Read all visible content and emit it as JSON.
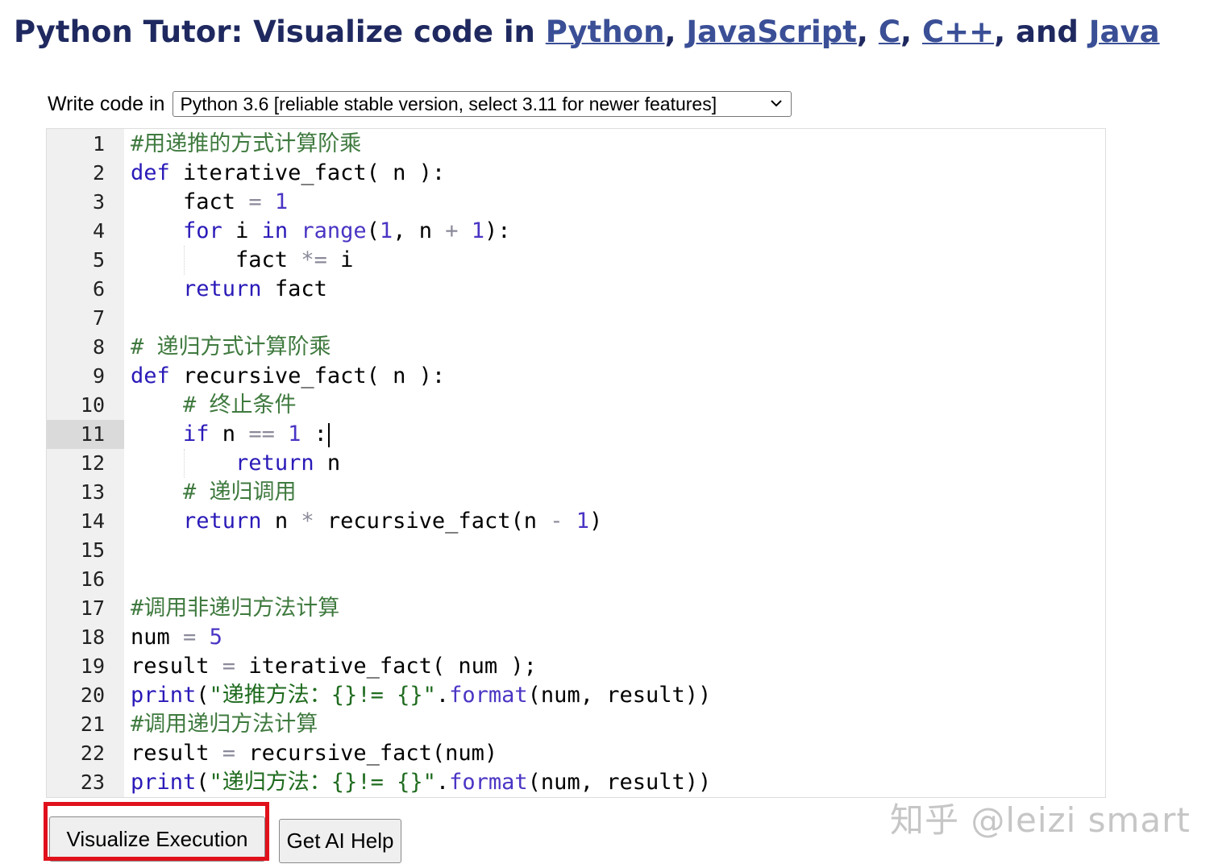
{
  "header": {
    "prefix": "Python Tutor: Visualize code in ",
    "lang_links": [
      "Python",
      "JavaScript",
      "C",
      "C++",
      "Java"
    ],
    "sep_comma": ", ",
    "sep_and": ", and "
  },
  "language_select": {
    "label": "Write code in",
    "selected": "Python 3.6 [reliable stable version, select 3.11 for newer features]"
  },
  "editor": {
    "active_line": 11,
    "lines": [
      {
        "n": "1",
        "t": "#用递推的方式计算阶乘"
      },
      {
        "n": "2",
        "t": "def iterative_fact( n ):"
      },
      {
        "n": "3",
        "t": "    fact = 1"
      },
      {
        "n": "4",
        "t": "    for i in range(1, n + 1):"
      },
      {
        "n": "5",
        "t": "        fact *= i"
      },
      {
        "n": "6",
        "t": "    return fact"
      },
      {
        "n": "7",
        "t": ""
      },
      {
        "n": "8",
        "t": "# 递归方式计算阶乘"
      },
      {
        "n": "9",
        "t": "def recursive_fact( n ):"
      },
      {
        "n": "10",
        "t": "    # 终止条件"
      },
      {
        "n": "11",
        "t": "    if n == 1 :"
      },
      {
        "n": "12",
        "t": "        return n"
      },
      {
        "n": "13",
        "t": "    # 递归调用"
      },
      {
        "n": "14",
        "t": "    return n * recursive_fact(n - 1)"
      },
      {
        "n": "15",
        "t": ""
      },
      {
        "n": "16",
        "t": ""
      },
      {
        "n": "17",
        "t": "#调用非递归方法计算"
      },
      {
        "n": "18",
        "t": "num = 5"
      },
      {
        "n": "19",
        "t": "result = iterative_fact( num );"
      },
      {
        "n": "20",
        "t": "print(\"递推方法：{}!= {}\".format(num, result))"
      },
      {
        "n": "21",
        "t": "#调用递归方法计算"
      },
      {
        "n": "22",
        "t": "result = recursive_fact(num)"
      },
      {
        "n": "23",
        "t": "print(\"递归方法：{}!= {}\".format(num, result))"
      }
    ]
  },
  "buttons": {
    "visualize": "Visualize Execution",
    "ai_help": "Get AI Help"
  },
  "watermark": "知乎 @leizi smart",
  "colors": {
    "title": "#1f2960",
    "link": "#3a4f96",
    "highlight_box": "#e0111b",
    "keyword": "#2a1ab8",
    "comment": "#3f7a3f",
    "string": "#1f6b1f"
  }
}
